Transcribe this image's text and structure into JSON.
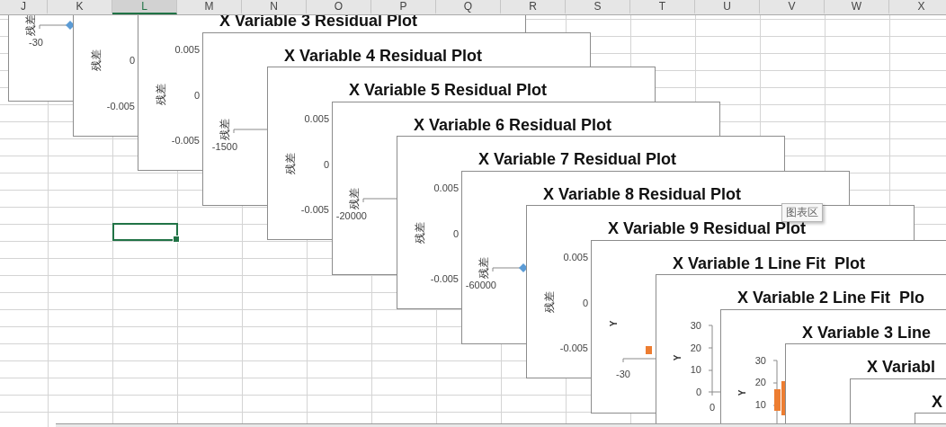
{
  "columns": [
    {
      "label": "J",
      "selected": false
    },
    {
      "label": "K",
      "selected": false
    },
    {
      "label": "L",
      "selected": true
    },
    {
      "label": "M",
      "selected": false
    },
    {
      "label": "N",
      "selected": false
    },
    {
      "label": "O",
      "selected": false
    },
    {
      "label": "P",
      "selected": false
    },
    {
      "label": "Q",
      "selected": false
    },
    {
      "label": "R",
      "selected": false
    },
    {
      "label": "S",
      "selected": false
    },
    {
      "label": "T",
      "selected": false
    },
    {
      "label": "U",
      "selected": false
    },
    {
      "label": "V",
      "selected": false
    },
    {
      "label": "W",
      "selected": false
    },
    {
      "label": "X",
      "selected": false
    }
  ],
  "charts": [
    {
      "kind": "residual_x",
      "axis_title": "残差",
      "tick": "-30",
      "point_visible": true
    },
    {
      "kind": "residual_y",
      "axis_title": "残差",
      "ticks": [
        "0",
        "-0.005"
      ]
    },
    {
      "kind": "residual_y",
      "title": "X Variable 3 Residual Plot",
      "axis_title": "残差",
      "ticks": [
        "0.005",
        "0",
        "-0.005"
      ]
    },
    {
      "kind": "residual_x",
      "title": "X Variable 4 Residual Plot",
      "axis_title": "残差",
      "tick": "-1500"
    },
    {
      "kind": "residual_y",
      "title": "X Variable 5 Residual Plot",
      "axis_title": "残差",
      "ticks": [
        "0.005",
        "0",
        "-0.005"
      ]
    },
    {
      "kind": "residual_x",
      "title": "X Variable 6 Residual Plot",
      "axis_title": "残差",
      "tick": "-20000"
    },
    {
      "kind": "residual_y",
      "title": "X Variable 7 Residual Plot",
      "axis_title": "残差",
      "ticks": [
        "0.005",
        "0",
        "-0.005"
      ]
    },
    {
      "kind": "residual_x",
      "title": "X Variable 8 Residual Plot",
      "axis_title": "残差",
      "tick": "-60000",
      "point_visible": true
    },
    {
      "kind": "residual_y",
      "title": "X Variable 9 Residual Plot",
      "axis_title": "残差",
      "ticks": [
        "0.005",
        "0",
        "-0.005"
      ]
    },
    {
      "kind": "fit_x",
      "title": "X Variable 1 Line Fit  Plot",
      "axis_title": "Y",
      "tick": "-30",
      "point_visible": true
    },
    {
      "kind": "fit_y",
      "title": "X Variable 2 Line Fit  Plo",
      "axis_title": "Y",
      "ticks": [
        "30",
        "20",
        "10",
        "0"
      ],
      "x_tick": "0"
    },
    {
      "kind": "fit_y",
      "title": "X Variable 3 Line",
      "axis_title": "Y",
      "ticks": [
        "30",
        "20",
        "10"
      ],
      "point_visible": true
    },
    {
      "kind": "plain",
      "title": "X Variabl"
    },
    {
      "kind": "plain",
      "title": "X"
    },
    {
      "kind": "plain"
    }
  ],
  "tooltip": "图表区"
}
